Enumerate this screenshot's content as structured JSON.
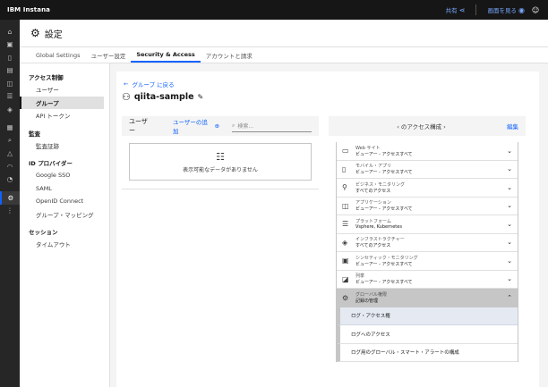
{
  "topbar": {
    "brand": "IBM Instana",
    "share": "共有",
    "view_dashboard": "画面を見る"
  },
  "header": {
    "title": "設定"
  },
  "tabs": [
    "Global Settings",
    "ユーザー設定",
    "Security & Access",
    "アカウントと請求"
  ],
  "sidebar": {
    "sections": [
      {
        "title": "アクセス制御",
        "items": [
          "ユーザー",
          "グループ",
          "API トークン"
        ]
      },
      {
        "title": "監査",
        "items": [
          "監査証跡"
        ]
      },
      {
        "title": "ID プロバイダー",
        "items": [
          "Google SSO",
          "SAML",
          "OpenID Connect",
          "グループ・マッピング"
        ]
      },
      {
        "title": "セッション",
        "items": [
          "タイムアウト"
        ]
      }
    ]
  },
  "main": {
    "back_label": "グループ に戻る",
    "group_name": "qiita-sample",
    "users_label": "ユーザー",
    "add_user_label": "ユーザーの追加",
    "search_placeholder": "検索...",
    "empty_text": "表示可能なデータがありません",
    "access_title": "‹ のアクセス構成 ›",
    "edit_label": "編集",
    "access_rows": [
      {
        "icon": "monitor-icon",
        "title": "Web サイト",
        "value": "ビューアー - アクセスすべて"
      },
      {
        "icon": "mobile-icon",
        "title": "モバイル・アプリ",
        "value": "ビューアー - アクセスすべて"
      },
      {
        "icon": "business-icon",
        "title": "ビジネス・モニタリング",
        "value": "すべてのアクセス"
      },
      {
        "icon": "application-icon",
        "title": "アプリケーション",
        "value": "ビューアー - アクセスすべて"
      },
      {
        "icon": "platform-icon",
        "title": "プラットフォーム",
        "value": "Vsphere, Kubernetes"
      },
      {
        "icon": "infrastructure-icon",
        "title": "インフラストラクチャー",
        "value": "すべてのアクセス"
      },
      {
        "icon": "synthetic-icon",
        "title": "シンセティック・モニタリング",
        "value": "ビューアー - アクセスすべて"
      },
      {
        "icon": "alert-icon",
        "title": "列挙",
        "value": "ビューアー - アクセスすべて"
      },
      {
        "icon": "global-icon",
        "title": "グローバル権限",
        "value": "記録の管理"
      }
    ],
    "sub_items": [
      "ログ・アクセス権",
      "ログへのアクセス",
      "ログ用のグローバル・スマート・アラートの構成"
    ]
  }
}
